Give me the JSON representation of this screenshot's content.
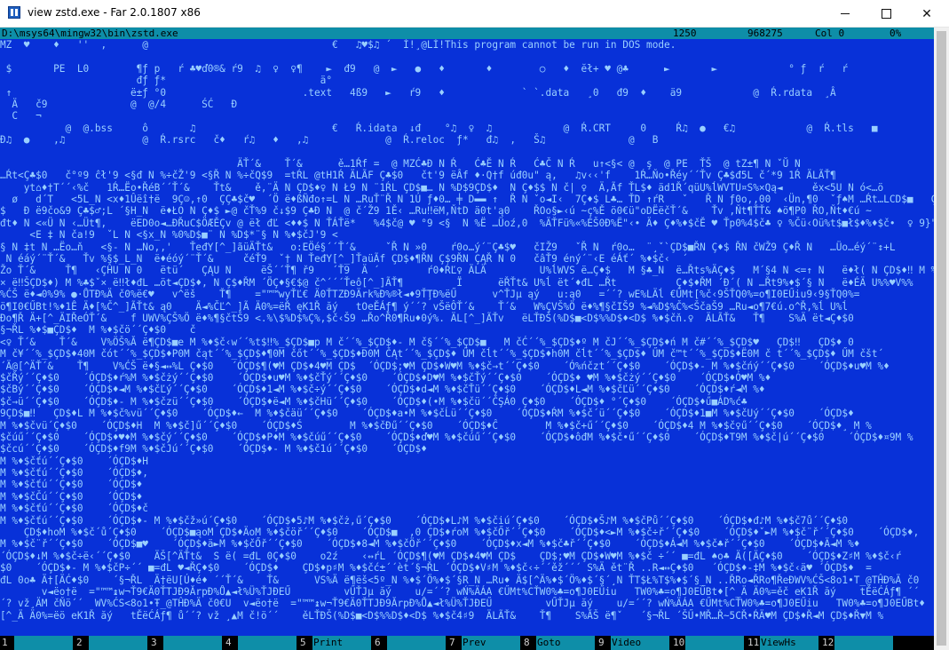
{
  "window": {
    "title": "view zstd.exe - Far 2.0.1807 x86",
    "icon": "far-manager-icon",
    "minimize_glyph": "",
    "close_glyph": "✕"
  },
  "colors": {
    "console_bg": "#0831d8",
    "text": "#9ad0ff",
    "status_bg": "#0e8ea8",
    "keybar_bg": "#000000"
  },
  "status": {
    "path": "D:\\msys64\\mingw32\\bin\\zstd.exe",
    "size": "1250",
    "offset": "968275",
    "column": "Col 0",
    "percent": "0%"
  },
  "dump_lines": [
    "MZ  ♥    ♦   ''  ,      @                               €   ♫♥$♫ ´  Í!¸@LÍ!This program cannot be run in DOS mode.",
    "",
    " $       PE  L0        ¶ƒ p   ŕ ♣♥ď0®& ŕ9  ♫  ♀  ♀¶    ►  đ9   @  ►   ●   ♦       ♦        ○   ♦  ĕł+ ♥ @♣      ►       ►            ° ƒ  ŕ   ŕ",
    "                       đƒ ƒ*                          ä°",
    " ↑                    ë±ƒ °0                       .text   4ß9   ►   ŕ9   ♦             ` `.data   ¸0   đ9  ♦    ä9            @  Ŕ.rdata  ¸Â",
    "  Ä   č9              @  @/4      ŚĆ   Ð",
    "  C   ¬",
    "           @  @.bss     ô       ♫                       €   Ŕ.idata  ↓đ    °♫  ♀  ♫            @  Ŕ.CRT     0     Ŕ♫  ●   €♫            @  Ŕ.tls   ■",
    "Đ♫  ●    ,♫             @  Ŕ.rsrc   č♦   ŕ♫   ♦   ,♫             @  Ŕ.reloc  ƒ*   đ♫  ,   Š♫              @   B",
    "",
    "                                        ÄŤ´&    Ť´&      ě…1Ŕf =  @ MZĆ♣Đ N Ŕ   Ć♣Ĕ N Ŕ   Ć♣Č N Ŕ   u↑<§< @  ş  @ PE  ŤŠ  @ tZ±¶ N ˇŬ N",
    "…Ŕt<Ç♣$0   č°º9 ĉł'9 <§đ N %÷čŽ'9 <§Ř N %÷čQ$9  =tŔL @tH1Ŕ ÄLÃF Ç♣$0   čt'9 ëÂf ♦·Q†f úđ0u\" ą,   ♫v‹‹'f    1Ŕ…Ňo•Řéy´´Ťv Ç♣$đ5L č´*9 1Ŕ ÄLÃŤ¶",
    "    yt⌂♦†T´´‹%č   1Ŕ…Ëo•ŘéB´´Ť´&    Ťt&    ě,¨Ä N ÇD$♦♀ N Ł9 N ¨1ŔL ÇD$■… N %D$9ÇD$♦  N Ç♦$$ N č| ♀  Ä,Ãf ŤL$♦ äd1Ř´qüU%ĺWVTU¤S%×Qą◄     ěx<5U N ó<…ö",
    "  ø   d´T   <5L_N <x♦1Ûëî†ë  9Ç☺,↑0  ÇÇ♣$č♥  ´Ö ë♦ßÑđo↑=L N …RuŤ¨Ř N 1Ú ƒ♦0… ╪ D▬▬ ↑  Ř N ˇo◄I‹  7Ç♦$ L♣… ŤD ↑ŕR   ˇ   Ř N ƒ0o,,00  ‹Ün,¶0  ˇƒ♠M …Ŕt…LCD$■   ÇD$♦ ●",
    "$   Đ ë9čo&9 Ç♣$♂;L ´§H_N  ë♦ŁO N Ç♦$ ►@ čŤ%9 č↓$9 Ç♣Đ N  @ č´Ž9 1Ě‹ …Ru‼ëM,ŇtD ä0t'ą0    ŘOo§►‹ú ~ç%Ě ö0€ü\"oDËëčŤ´&    Ťv ,Ňt¶ŤŤ& ♠ö¶P0 ŘO,Ňt♦€ú ~",
    "đt♦ N <«Ü N ‹…Üt¶,    ëED0o◄…ĐŘuC$ÖÆĚÇv @ ëł đĽ <♦♦$ N ŤÁŤë*   %4$č@ ♥ °9 <§  N %Ë …Üoź,0  %ÄŤFü%«%ÉŠ0Đ%Ë\"‹• Ä♦ Ç♦%♦$čĚ ♥ Ťp0%4$č♣ ♀ %Čü‹Oü%t$■ł$♦%♦$č•  ♀ 9}\"uĘ<EŠ♥E",
    "     <E ‡ N ča!9  ˇL N <§x_N %0%D$■¨ N %D$*¨§ N %♦$čJ'9 <",
    "§ N ‡t N …Ëo…ň   <§- N …No,,'   ŤeđY[^_]ãüÄŤt&   o:EÖé§´´Ť´&     ˇŘ N »0    ŕ0o…ý´¨Ç♣$♥   čIŽ9   ˇŘ N  ŕ0o…  ¨¸ˇ`ÇD$■ŘN Ç♦$ ŘN čWŽ9 Ç♦Ř N   …Üo…éý´¨↕+L",
    " N éáý´¨Ť´&   Ťv %§$_L_N  ë♦éóý´¨Ť´&     čéŤ9  ˇ† N ŤeđY[^_]ŤaüÃf ÇD$♦¶ŘN Ç$9ŘN ÇĄŘ N 0   čâŤ9 éný´¨‹E éÁť´ %♦$č‹  ´",
    "Žo Ť´&     Ť¶   ‹ÇĤU N 0   ëtü´   ÇĄU N     ëŠ´´Ť¶ ř9   ´Ť9  Ä ´        ŕ0♦ŔĽ♀ ÄLÄ         U%ĺWVS ë…Ç♦$   M §♣_N  ë…Řts%ÄÇ♦$   M´§4 N <=↑ N   ë♦ł( N ÇD$♦‼ M %é§",
    "× ë‼ŠÇD$♦) M %♣$ˇ× ë‼ł♦đL …öt◄ÇD$♦, N Ç$♦ŘM ´ÖÇ♦§€$@ č^´´´Ťeô[^_]ÃŤ¶         Ï      ëŘŤt& U%ĺ ët´♦đL …Řt          Ç♦$♦ŘM ´Đ´( N …Řt9%♦$´§ N   ë♦ÉÄ U%%♥V%%",
    "%ĆŠ ë♦◄0%9% ●·ŮTĐ%Ä č0%ë€♥   v^ëš    Ť¶    =\"™™wyŤĽ€ Ä0ŤTZĐ9Ärk%Đ%®ł◄♦9ŤŢĐ%ëŰ      v^ŤJµ ąý   u:ą0   =´´? wE%LÄĺ €ŰMt[%č‹9ŠŤQ0%=o¶I0EŰiu9‹9§ŤQ0%=",
    "ö¶I0€ŰBt!%♦1Ê Ä♦[%Č^_]ÃŤt& ą0    Ä◄%ČĽ^_]Ã Ä0%=ëŘ ęK1Ř ăý   tOeĚÁƒ¶ ý´´? vŠëÔŤ´&    Ť´&   W%ÇVŠ%Ö ë♦%¶§čIŠ9 %◄%D$%Č%<ŠčaŠ9 …Ru◄o¶7€ú.o^Ř,%ĺ U%ĺ",
    "Đo¶Ř Ä+[^_ÄIŘeÓŤ´&    f UWV%ÇŠ%Ö ë♦%¶§čtŠ9 <.%\\$%D$%Ç%,$č‹Š9 …Řo^Ř0¶Ru♦0ý%. ÄL[^_]ÃŤv   ëLŤĐŠ(%D$■<D$%%D$♦<D$ %♦$čň.♀  ÄLÃŤ&   Ť¶    S%Ä ët◄Ç♦$0  ",
    "§¬ŘL %♦$■ÇD$♦  M %♦$čö´´Ç♦$0    č",
    "<♀ Ť´&    Ť´&    V%ÖŠ%Ă ë¶ÇD$■e M %♦$č‹w´´%t$‼%_$ÇD$■p M č´´%_$ÇD$♦- M č§´´%_$ÇD$■   M čĆ´´%_$ÇD$♦º M čJ´´%_$ÇD$♦ń M č#´´%_$ÇD$♥   ÇD$‼   ÇD$♦ 0",
    "M č¥´´%_$ÇD$♦40M čót´´%_$ÇD$♦P0M čąt´´%_$ÇD$♦¶0M čőt´´%_$ÇD$♦Đ0M ČĄt´´%_$ÇD$♦ ŰM čĺt´´%_$ÇD$♦h0M čĺt´´%_$ÇD$♦ ŰM č™t´´%_$ÇD$♦Ë0M č t´´%_$ÇD$♦ ŰM čšt´",
    "´Ä@[^ÄŤ´&    Ť¶    V%ĆŠ ë♦§◄↔%L Ç♦$0   ´ÓÇD$¶(♥M ÇD$♦4♥M ÇD$  ´ÓÇD$;♥M ÇD$♦W♥M %♦$č→t´´Ç♦$0    ´Ó%ńčzt´´Ç♦$0    ´ÓÇD$♦- M %♦$čńý´´Ç♦$0    ´ÓÇD$♦u♥M %♦",
    "$čŘý´´Ç♦$0    ´ÓÇD$♦ŕ%M %♦$čżý´´Ç♦$0    ´ÓÇD$♦u♥M %♦$čŤý´´Ç♦$0    ´ÓÇD$♦D♥M %♦$čŤý´´Ç♦$0    ´ÓÇD$♦ ♥M %♦$čżý´´Ç♦$0    ´ÓÇD$♦Ó♥M %♦",
    "$čBý´´Ç♦$0    ´ÓÇD$♦◄M %♦$čĽý´´Ç♦$0    ´ÓÇD$♦1◄M %♦$č÷ý´´Ç♦$0    ´ÓÇD$♦d◄M %♦$čŤü´´Ç♦$0    ´ÓÇD$♦L◄M %♦$čĽü´´Ç♦$0    ´ÓÇD$♦ŕ◄M %♦",
    "$č→ü´´Ç♦$0    ´ÓÇD$♦- M %♦$čzü´´Ç♦$0    ´ÓÇD$♦ë◄M %♦$čHü´´Ç♦$0    ´ÓÇD$♦(•M %♦$čü´´ČŞÁ0 Ç♦$0    ´ÓÇD$♦ °´Ç♦$0    ´ÓÇD$♦ű■ÁD%ć♣",
    "9ÇD$■‼   ÇD$♦L M %♦$č%vü´´Ç♦$0    ´ÓÇD$♦←  M %♦$čäü´´Ç♦$0    ´ÓÇD$♦a•M %♦$čĹü´´Ç♦$0    ´ÓÇD$♦ŔM %♦$č´ü´´Ç♦$0    ´ÓÇD$♦1■M %♦$čUý´´Ç♦$0    ´ÓÇD$♦",
    "M %♦$čvü´Ç♦$0    ´ÓÇD$♦H  M %♦$č]ű´´Ç♦$0    ´ÓÇD$♦Ś        M %♦$čĐű´´Ç♦$0    ´ÓÇD$♦Ĉ        M %♦$č+ű´´Ç♦$0    ´ÓÇD$♦4 M %♦$č♀ű´´Ç♦$0    ´ÓÇD$♦¸ M %",
    "$čúű´´Ç♦$0    ´ÓÇD$♦♥♦M %♦$čý´´Ç♦$0    ´ÓÇD$♦P♦M %♦$čúű´´Ç♦$0    ´ÓÇD$♦ď♥M %♦$čúű´´Ç♦$0    ´ÓÇD$♦ôđM %♦$č•ű´´Ç♦$0    ´ÓÇD$♦T9M %♦$č|ú´´Ç♦$0    ´ÓÇD$♦¤9M %",
    "$čcú´´Ç♦$0    ´ÓÇD$♦f9M %♦$čJú´´Ç♦$0    ´ÓÇD$♦- M %♦$č1ú´´Ç♦$0    ´ÓÇD$♦",
    "M %♦$čťú´´Ç♦$0    ´ÓÇD$♦H",
    "M %♦$čťú´´Ç♦$0    ´ÓÇD$♦,",
    "M %♦$čťú´´Ç♦$0    ´ÓÇD$♦",
    "M %♦$čČú´´Ç♦$0    ´ÓÇD$♦",
    "M %♦$čťú´´Ç♦$0    ´ÓÇD$♦č",
    "M %♦$čťú´´Ç♦$0    ´ÓÇD$♦- M %♦$čž»ú´Ç♦$0    ´ÓÇD$♦5♪M %♦$čż,ű´Ç♦$0    ´ÓÇD$♦L♪M %♦$čiú´Ç♦$0    ´ÓÇD$♦Š♪M %♦$čPů´´Ç♦$0    ´ÓÇD$♦đ♪M %♦$č7ů´´Ç♦$0",
    "    ÇD$♦hoM %♦$č´ů´Ç♦$0    ´ÓÇD$■ąoM ÇD$♦ÄoM %♦$čöř´´Ç♦$0    ´ÓÇD$■  ,0 ÇD$♦ŕoM %♦$čŐř´´Ç♦$0    ´ÓÇD$♦<►M %♦$č÷ř´´Ç♦$0    ´ÓÇD$♦ˇ►M %♦$č¨ř´´Ç♦$0    ´ÓÇD$♦,",
    "M %♦$č¨ř´´Ç♦$0    ´ÓÇD$■♥    ´ÓÇD$♦ä►M %♦$čŐř´´Ç♦$0    ´ÓÇD$♦8◄M %♦$čÖř´´Ç♦$0    ´ÓÇD$♦x◄M %♦$č♣ř´´Ç♦$0    ´ÓÇD$♦Á◄M %♦$č♣ř´´Ç♦$0    ´ÓÇD$♦Ä◄M %♦",
    "´ÓÇD$♦↓M %♦$č÷ë‹´´Ç♦$0    ÄŠ[^ÄŤt&  S ë( =đL 0Ç♦$0    o2ź    ‹↔ŕL ´ÓÇD$¶(♥M ÇD$♦4♥M ÇD$    ÇD$;♥M ÇD$♦W♥M %♦$č ÷´´ ■=đL ♠o♣ Ä([ÄÇ♦$0    ´ÓÇD$♦Z♯M %♦$č‹ŕ",
    "$0    ´ÓÇD$♦- M %♦$čP÷´´ ■=đL ♥◄ŘÇ♦$0    ´ÓÇD$♦    ÇD$♦p♯M %♦$čć±´´èt´§¬ŘL ´ÓÇD$♦V♯M %♦$č‹÷´´ěž´´´ S%Ä ět¨Ř ..R◄↔Ç♦$0   ´ÓÇD$♦-‡M %♦$č‹ä♥ ´ÓÇD$♦  =",
    "đL 0o♣ Ä†[ÄĆ♦$0    ´§¬ŘL  Ä†ëU[Ú♦é♦ ´´Ť´&    Ť&      VS%Ä ë¶ëš<5º_N %♦$´Ö%♦$´§R_N …Ru♦ Ä$[^Ä%♦$´Ö%♦$´§´¸N ŤT$Ł%T$%♦$´§_N ..ŘRo◄ŘRo¶ŘeĐWV%ĆŠ<8o1•T_@TĤĐ%Ä č0",
    "       v◄ëo†ë  =\"™™↨w¬Ť9€Ä0ŤTJĐ9ĂrpĐ%Ů▲◄ł%Ü%ŤJĐEŰ         vŰŤJµ ăý    u/=´´? wŃ%ÄÁA €ŰMt%CŤW0%♣=o¶J0EŰiu   TW0%♣=o¶J0EŰBt♦[^_Ä Ä0%=ěč eK1Ř ăý    tĚëĆÁƒ¶ ´´",
    "´? vž¸ÄM čŇö´´  WV%ĆS<8o1•Ŧ_@TĤĐ%Ä č0€U  v◄ëo†ë  =\"™™↨w¬Ť9€Ä0ŤTJĐ9ĂrpĐ%Ů▲◄ł%Ü%ŤJĐEŰ         vŰŤJµ ăý    u/=´´? wŃ%ÄÁA €ŰMt%CŤW0%♣=o¶J0EŰiu   TW0%♣=o¶J0EŰBt♦",
    "[^_Ä Ä0%=ëö eK1Ř ăý   tĚëĆÁƒ¶ ů´´? vž ¸▲M č!ö´´    ěLŤĐŠ(%D$■<D$%%D$♦<D$ %♦$č4♯9  ÄLÃŤ&    Ť¶    S%ĂŠ ë¶ˇ   ´§¬ŘL ´ŠŰ•MŘ…Ř~5CŘ•ŔÄ♥M ÇD$♦Ř◄M ÇD$♦Ř▼M %"
  ],
  "keybar": [
    {
      "num": "1",
      "label": ""
    },
    {
      "num": "2",
      "label": ""
    },
    {
      "num": "3",
      "label": ""
    },
    {
      "num": "4",
      "label": ""
    },
    {
      "num": "5",
      "label": "Print"
    },
    {
      "num": "6",
      "label": ""
    },
    {
      "num": "7",
      "label": "Prev"
    },
    {
      "num": "8",
      "label": "Goto"
    },
    {
      "num": "9",
      "label": "Video"
    },
    {
      "num": "10",
      "label": ""
    },
    {
      "num": "11",
      "label": "ViewHs"
    },
    {
      "num": "12",
      "label": ""
    }
  ]
}
